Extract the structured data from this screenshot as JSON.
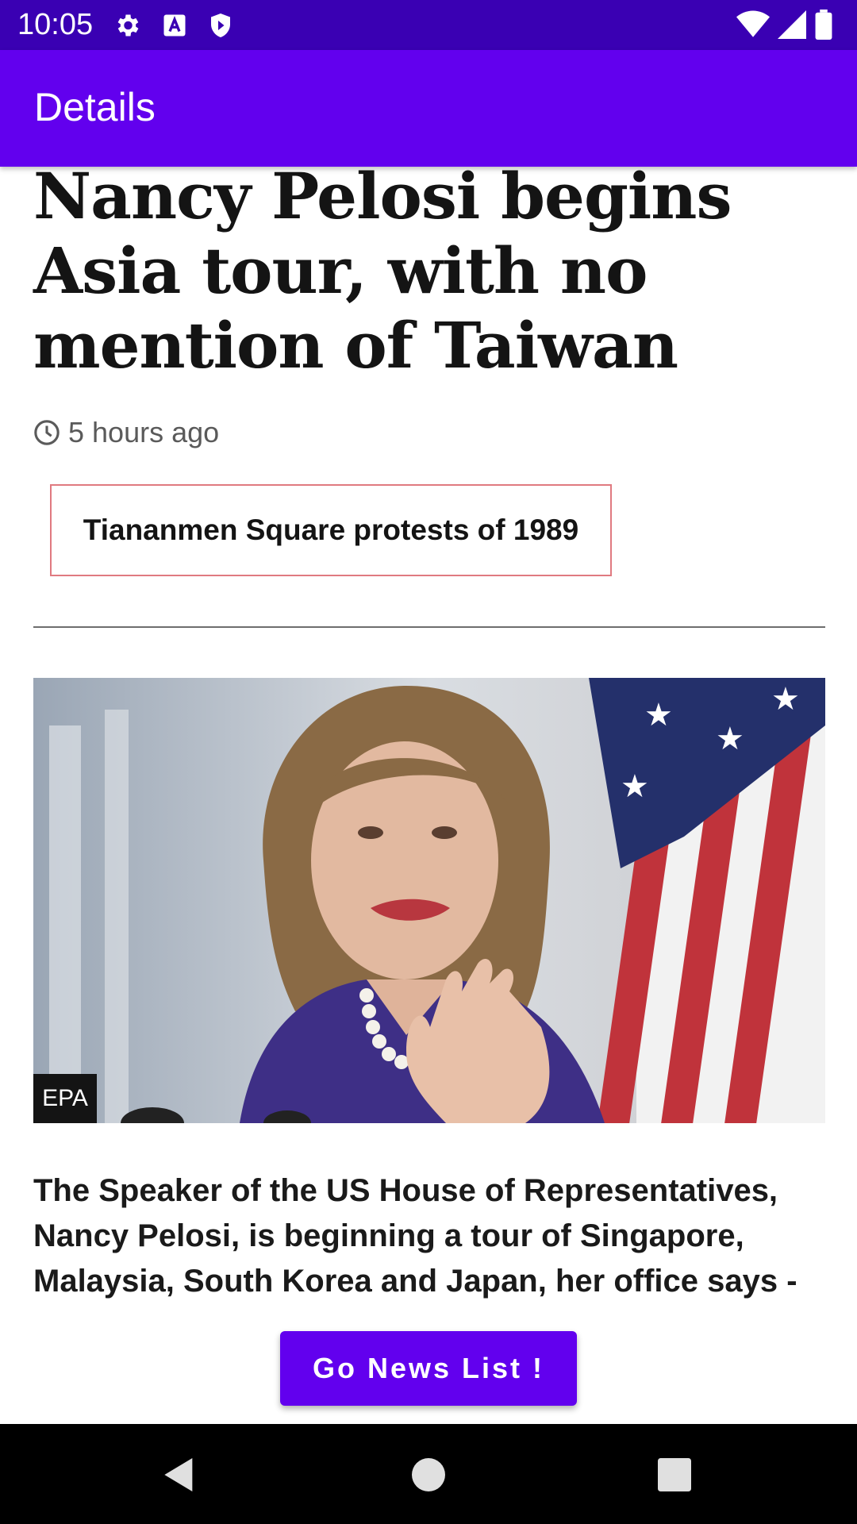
{
  "status_bar": {
    "time": "10:05",
    "left_icons": [
      "gear-icon",
      "text-a-icon",
      "shield-play-icon"
    ],
    "right_icons": [
      "wifi-icon",
      "signal-icon",
      "battery-icon"
    ]
  },
  "app_bar": {
    "title": "Details"
  },
  "article": {
    "headline": "Nancy Pelosi begins Asia tour, with no mention of Taiwan",
    "timestamp": "5 hours ago",
    "topic": "Tiananmen Square protests of 1989",
    "image_credit": "EPA",
    "summary": "The Speaker of the US House of Representatives, Nancy Pelosi, is beginning a tour of Singapore, Malaysia, South Korea and Japan, her office says -"
  },
  "actions": {
    "go_news_list": "Go News List !"
  },
  "colors": {
    "status_bar": "#3a00b3",
    "app_bar": "#6200ee",
    "topic_border": "#e07a80"
  }
}
